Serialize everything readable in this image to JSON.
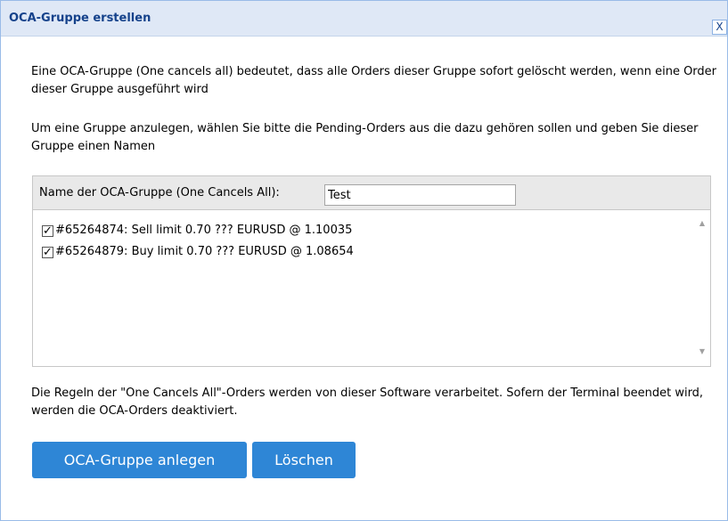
{
  "window": {
    "title": "OCA-Gruppe erstellen",
    "close_label": "X"
  },
  "text": {
    "intro": "Eine OCA-Gruppe (One cancels all) bedeutet, dass alle Orders dieser Gruppe sofort gelöscht werden, wenn eine Order dieser Gruppe ausgeführt wird",
    "instructions": "Um eine Gruppe anzulegen, wählen Sie bitte die Pending-Orders aus die dazu gehören sollen und geben Sie dieser Gruppe einen Namen",
    "rules": "Die Regeln der \"One Cancels All\"-Orders werden von dieser Software verarbeitet. Sofern der Terminal beendet wird, werden die OCA-Orders deaktiviert."
  },
  "group": {
    "name_label": "Name der OCA-Gruppe (One Cancels All):",
    "name_value": "Test"
  },
  "orders": [
    {
      "checked": true,
      "check_glyph": "✓",
      "label": "#65264874: Sell limit 0.70 ??? EURUSD @ 1.10035"
    },
    {
      "checked": true,
      "check_glyph": "✓",
      "label": "#65264879: Buy limit 0.70 ??? EURUSD @ 1.08654"
    }
  ],
  "scroll": {
    "up_glyph": "▲",
    "down_glyph": "▼"
  },
  "buttons": {
    "create_label": "OCA-Gruppe anlegen",
    "delete_label": "Löschen"
  },
  "colors": {
    "titlebar_bg": "#dfe8f6",
    "title_text": "#15428b",
    "button_bg": "#2e86d6"
  }
}
